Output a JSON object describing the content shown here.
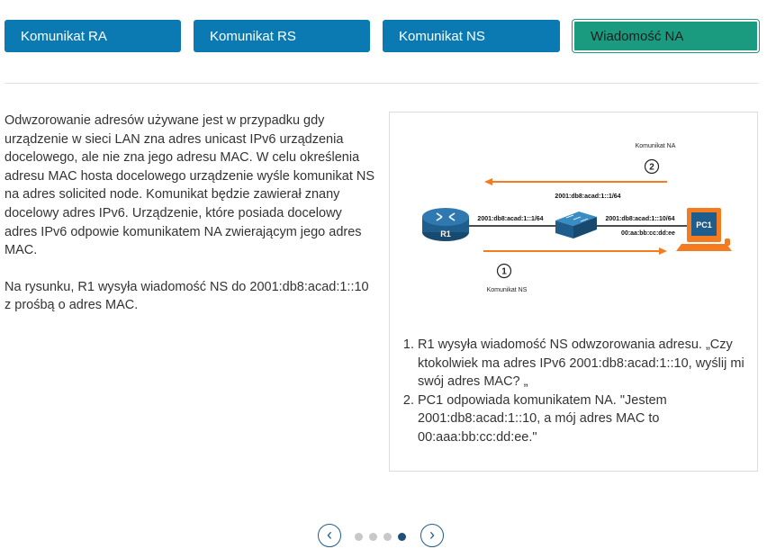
{
  "tabs": [
    {
      "label": "Komunikat RA",
      "active": false
    },
    {
      "label": "Komunikat RS",
      "active": false
    },
    {
      "label": "Komunikat NS",
      "active": false
    },
    {
      "label": "Wiadomość NA",
      "active": true
    }
  ],
  "content": {
    "paragraph1": "Odwzorowanie adresów używane jest w przypadku gdy urządzenie w sieci LAN zna adres unicast IPv6 urządzenia docelowego, ale nie zna jego adresu MAC. W celu określenia adresu MAC hosta docelowego urządzenie wyśle komunikat NS na adres solicited node. Komunikat będzie zawierał znany docelowy adres IPv6. Urządzenie, które posiada docelowy adres IPv6 odpowie komunikatem NA zwierającym jego adres MAC.",
    "paragraph2": "Na rysunku, R1 wysyła wiadomość NS do 2001:db8:acad:1::10 z prośbą o adres MAC."
  },
  "diagram": {
    "label_na": "Komunikat NA",
    "label_ns": "Komunikat NS",
    "step_top": "2",
    "step_bottom": "1",
    "address_top": "2001:db8:acad:1::1/64",
    "r1_address": "2001:db8:acad:1::1/64",
    "pc1_address": "2001:db8:acad:1::10/64",
    "pc1_mac": "00:aa:bb:cc:dd:ee",
    "r1_label": "R1",
    "pc1_label": "PC1",
    "colors": {
      "arrow": "#f47b20",
      "router": "#1f5e8c",
      "pc": "#f47b20",
      "switch": "#1f5e8c"
    }
  },
  "steps": [
    "R1 wysyła wiadomość NS odwzorowania adresu. „Czy ktokolwiek ma adres IPv6 2001:db8:acad:1::10, wyślij mi swój adres MAC? „",
    "PC1 odpowiada komunikatem NA. \"Jestem 2001:db8:acad:1::10, a mój adres MAC to 00:aaa:bb:cc:dd:ee.\""
  ],
  "pager": {
    "prev_icon": "chevron-left-icon",
    "next_icon": "chevron-right-icon",
    "total": 4,
    "current": 4
  }
}
